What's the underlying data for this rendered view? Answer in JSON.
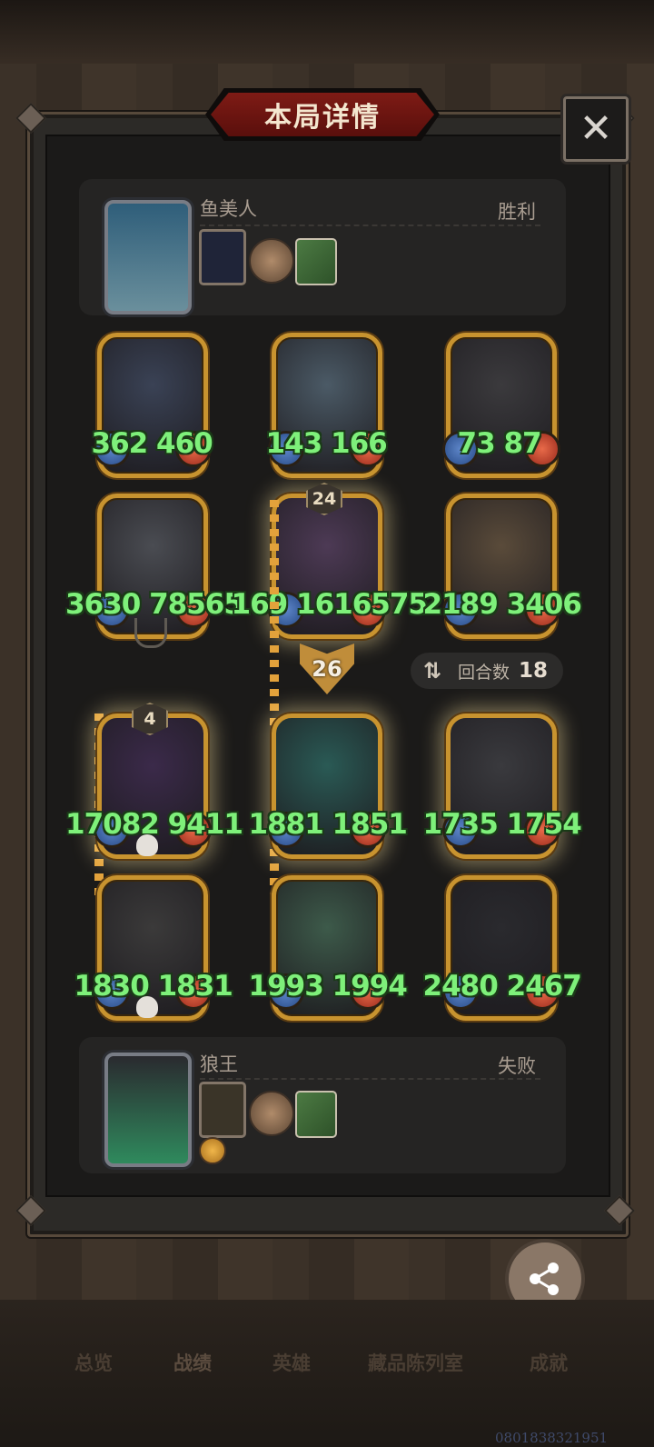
{
  "title": "本局详情",
  "close_icon": "close-icon",
  "top_player": {
    "name": "鱼美人",
    "result": "胜利"
  },
  "bottom_player": {
    "name": "狼王",
    "result": "失败"
  },
  "board_top": [
    {
      "attack": "362",
      "health": "460"
    },
    {
      "attack": "143",
      "health": "166"
    },
    {
      "attack": "73",
      "health": "87"
    },
    {
      "attack": "3630",
      "health": "78565"
    },
    {
      "attack": "169",
      "health": "1616575",
      "level": "24"
    },
    {
      "attack": "2189",
      "health": "3406"
    }
  ],
  "board_bottom": [
    {
      "attack": "17082",
      "health": "9411",
      "level": "4"
    },
    {
      "attack": "1881",
      "health": "1851"
    },
    {
      "attack": "1735",
      "health": "1754"
    },
    {
      "attack": "1830",
      "health": "1831"
    },
    {
      "attack": "1993",
      "health": "1994"
    },
    {
      "attack": "2480",
      "health": "2467"
    }
  ],
  "attack_value": "26",
  "round": {
    "label": "回合数",
    "value": "18"
  },
  "share_label": "分享",
  "tabs": [
    "总览",
    "战绩",
    "英雄",
    "藏品陈列室",
    "成就"
  ],
  "watermark": "0801838321951",
  "colors": {
    "stat_green": "#7ef07a",
    "gold_frame": "#c8932f",
    "banner_red": "#7e1b15"
  }
}
